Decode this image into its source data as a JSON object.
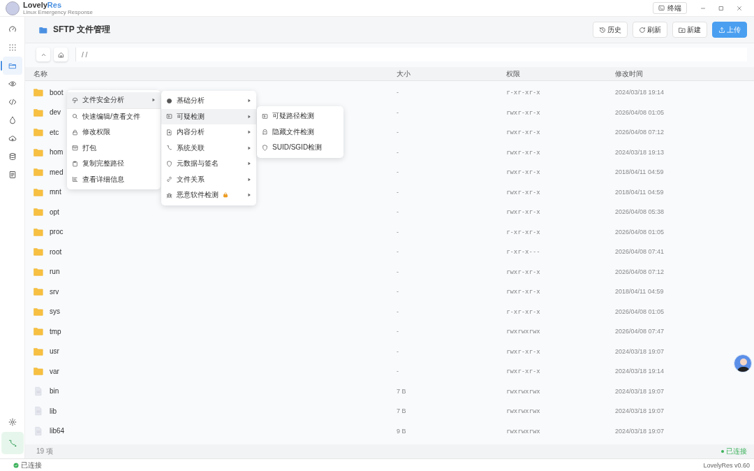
{
  "app": {
    "name_main": "Lovely",
    "name_accent": "Res",
    "subtitle": "Linux Emergency Response"
  },
  "titlebar": {
    "terminal_button": "终端"
  },
  "sidebar": {
    "items": [
      {
        "selected": false
      },
      {
        "selected": false
      },
      {
        "selected": true
      },
      {
        "selected": false
      },
      {
        "selected": false
      },
      {
        "selected": false
      },
      {
        "selected": false
      },
      {
        "selected": false
      },
      {
        "selected": false
      }
    ]
  },
  "header": {
    "title": "SFTP 文件管理",
    "buttons": [
      {
        "label": "历史",
        "kind": "plain"
      },
      {
        "label": "刷新",
        "kind": "plain"
      },
      {
        "label": "新建",
        "kind": "plain"
      },
      {
        "label": "上传",
        "kind": "primary"
      }
    ]
  },
  "path": "/ /",
  "table": {
    "columns": [
      "名称",
      "大小",
      "权限",
      "修改时间"
    ],
    "rows": [
      {
        "kind": "folder",
        "name": "boot",
        "size": "-",
        "perm": "r-xr-xr-x",
        "time": "2024/03/18 19:14"
      },
      {
        "kind": "folder",
        "name": "dev",
        "size": "-",
        "perm": "rwxr-xr-x",
        "time": "2026/04/08 01:05"
      },
      {
        "kind": "folder",
        "name": "etc",
        "size": "-",
        "perm": "rwxr-xr-x",
        "time": "2026/04/08 07:12"
      },
      {
        "kind": "folder",
        "name": "hom",
        "size": "-",
        "perm": "rwxr-xr-x",
        "time": "2024/03/18 19:13"
      },
      {
        "kind": "folder",
        "name": "med",
        "size": "-",
        "perm": "rwxr-xr-x",
        "time": "2018/04/11 04:59"
      },
      {
        "kind": "folder",
        "name": "mnt",
        "size": "-",
        "perm": "rwxr-xr-x",
        "time": "2018/04/11 04:59"
      },
      {
        "kind": "folder",
        "name": "opt",
        "size": "-",
        "perm": "rwxr-xr-x",
        "time": "2026/04/08 05:38"
      },
      {
        "kind": "folder",
        "name": "proc",
        "size": "-",
        "perm": "r-xr-xr-x",
        "time": "2026/04/08 01:05"
      },
      {
        "kind": "folder",
        "name": "root",
        "size": "-",
        "perm": "r-xr-x---",
        "time": "2026/04/08 07:41"
      },
      {
        "kind": "folder",
        "name": "run",
        "size": "-",
        "perm": "rwxr-xr-x",
        "time": "2026/04/08 07:12"
      },
      {
        "kind": "folder",
        "name": "srv",
        "size": "-",
        "perm": "rwxr-xr-x",
        "time": "2018/04/11 04:59"
      },
      {
        "kind": "folder",
        "name": "sys",
        "size": "-",
        "perm": "r-xr-xr-x",
        "time": "2026/04/08 01:05"
      },
      {
        "kind": "folder",
        "name": "tmp",
        "size": "-",
        "perm": "rwxrwxrwx",
        "time": "2026/04/08 07:47"
      },
      {
        "kind": "folder",
        "name": "usr",
        "size": "-",
        "perm": "rwxr-xr-x",
        "time": "2024/03/18 19:07"
      },
      {
        "kind": "folder",
        "name": "var",
        "size": "-",
        "perm": "rwxr-xr-x",
        "time": "2024/03/18 19:14"
      },
      {
        "kind": "file",
        "name": "bin",
        "size": "7 B",
        "perm": "rwxrwxrwx",
        "time": "2024/03/18 19:07"
      },
      {
        "kind": "file",
        "name": "lib",
        "size": "7 B",
        "perm": "rwxrwxrwx",
        "time": "2024/03/18 19:07"
      },
      {
        "kind": "file",
        "name": "lib64",
        "size": "9 B",
        "perm": "rwxrwxrwx",
        "time": "2024/03/18 19:07"
      }
    ]
  },
  "footer": {
    "count": "19 项",
    "status": "已连接"
  },
  "menus": [
    {
      "items": [
        {
          "label": "文件安全分析",
          "submenu": true,
          "selected": true,
          "separator_after": true
        },
        {
          "label": "快速编辑/查看文件",
          "submenu": false,
          "selected": false
        },
        {
          "label": "修改权限",
          "submenu": false,
          "selected": false
        },
        {
          "label": "打包",
          "submenu": false,
          "selected": false
        },
        {
          "label": "复制完整路径",
          "submenu": false,
          "selected": false
        },
        {
          "label": "查看详细信息",
          "submenu": false,
          "selected": false
        }
      ]
    },
    {
      "items": [
        {
          "label": "基础分析",
          "submenu": true,
          "selected": false
        },
        {
          "label": "可疑检测",
          "submenu": true,
          "selected": true
        },
        {
          "label": "内容分析",
          "submenu": true,
          "selected": false
        },
        {
          "label": "系统关联",
          "submenu": true,
          "selected": false
        },
        {
          "label": "元数据与签名",
          "submenu": true,
          "selected": false
        },
        {
          "label": "文件关系",
          "submenu": true,
          "selected": false
        },
        {
          "label": "恶意软件检测",
          "submenu": true,
          "selected": false,
          "locked": true
        }
      ]
    },
    {
      "items": [
        {
          "label": "可疑路径检测",
          "submenu": false,
          "selected": false
        },
        {
          "label": "隐藏文件检测",
          "submenu": false,
          "selected": false
        },
        {
          "label": "SUID/SGID检测",
          "submenu": false,
          "selected": false
        }
      ]
    }
  ],
  "statusbar": {
    "connection": "已连接",
    "version": "LovelyRes v0.60"
  }
}
